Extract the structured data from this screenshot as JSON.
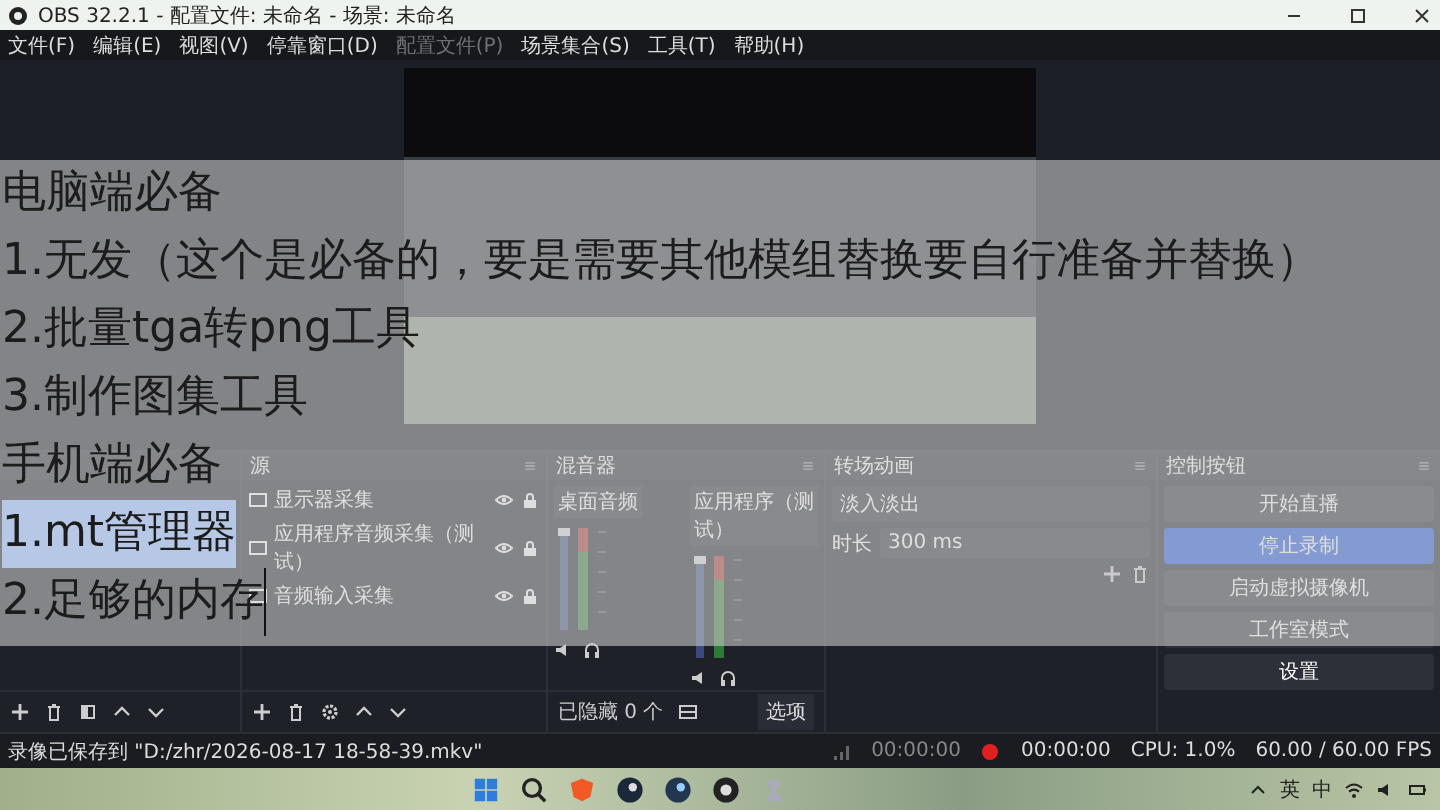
{
  "window": {
    "title": "OBS 32.2.1 - 配置文件: 未命名 - 场景: 未命名"
  },
  "menu": [
    {
      "label": "文件(F)",
      "disabled": false
    },
    {
      "label": "编辑(E)",
      "disabled": false
    },
    {
      "label": "视图(V)",
      "disabled": false
    },
    {
      "label": "停靠窗口(D)",
      "disabled": false
    },
    {
      "label": "配置文件(P)",
      "disabled": true
    },
    {
      "label": "场景集合(S)",
      "disabled": false
    },
    {
      "label": "工具(T)",
      "disabled": false
    },
    {
      "label": "帮助(H)",
      "disabled": false
    }
  ],
  "overlay": {
    "lines": [
      {
        "text": "电脑端必备",
        "selected": false,
        "caret": false
      },
      {
        "text": "1.无发（这个是必备的，要是需要其他模组替换要自行准备并替换）",
        "selected": false,
        "caret": false
      },
      {
        "text": "2.批量tga转png工具",
        "selected": false,
        "caret": false
      },
      {
        "text": "3.制作图集工具",
        "selected": false,
        "caret": false
      },
      {
        "text": "手机端必备",
        "selected": false,
        "caret": false
      },
      {
        "text": "1.mt管理器",
        "selected": true,
        "caret": false
      },
      {
        "text": "2.足够的内存",
        "selected": false,
        "caret": true
      }
    ]
  },
  "sources": {
    "title": "源",
    "items": [
      {
        "name": "显示器采集"
      },
      {
        "name": "应用程序音频采集（测试）"
      },
      {
        "name": "音频输入采集"
      }
    ]
  },
  "mixer": {
    "title": "混音器",
    "channels": [
      {
        "name": "桌面音频"
      },
      {
        "name": "应用程序（测试）"
      }
    ],
    "hidden_count": "已隐藏 0 个",
    "options": "选项"
  },
  "transitions": {
    "title": "转场动画",
    "selected": "淡入淡出",
    "duration_label": "时长",
    "duration": "300 ms"
  },
  "controls": {
    "title": "控制按钮",
    "buttons": [
      {
        "label": "开始直播",
        "selected": false
      },
      {
        "label": "停止录制",
        "selected": true
      },
      {
        "label": "启动虚拟摄像机",
        "selected": false
      },
      {
        "label": "工作室模式",
        "selected": false
      },
      {
        "label": "设置",
        "selected": false
      }
    ]
  },
  "status_bar": {
    "message": "录像已保存到 \"D:/zhr/2026-08-17 18-58-39.mkv\"",
    "stream_time": "00:00:00",
    "record_time": "00:00:00",
    "cpu": "CPU: 1.0%",
    "fps": "60.00 / 60.00 FPS"
  },
  "taskbar": {
    "tray": [
      "英",
      "中"
    ]
  }
}
